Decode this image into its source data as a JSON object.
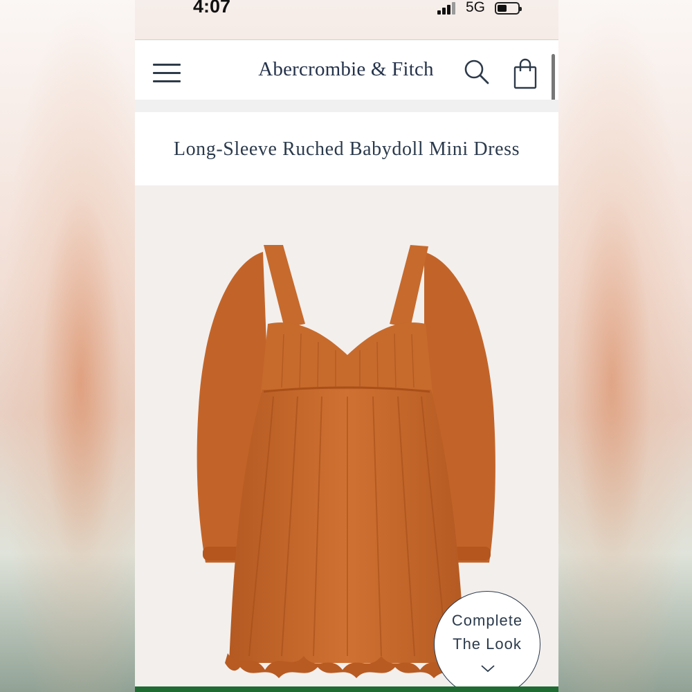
{
  "status_bar": {
    "time": "4:07",
    "network": "5G"
  },
  "header": {
    "brand": "Abercrombie & Fitch"
  },
  "product": {
    "title": "Long-Sleeve Ruched Babydoll Mini Dress",
    "image_alt_color": "#c96a2b"
  },
  "complete_look": {
    "line1": "Complete",
    "line2": "The Look"
  },
  "colors": {
    "brand_navy": "#24324a",
    "accent_green": "#1f6b33",
    "dress_rust": "#c96a2b"
  },
  "icons": {
    "menu": "hamburger-icon",
    "search": "search-icon",
    "bag": "shopping-bag-icon",
    "expand": "chevron-down-icon"
  }
}
